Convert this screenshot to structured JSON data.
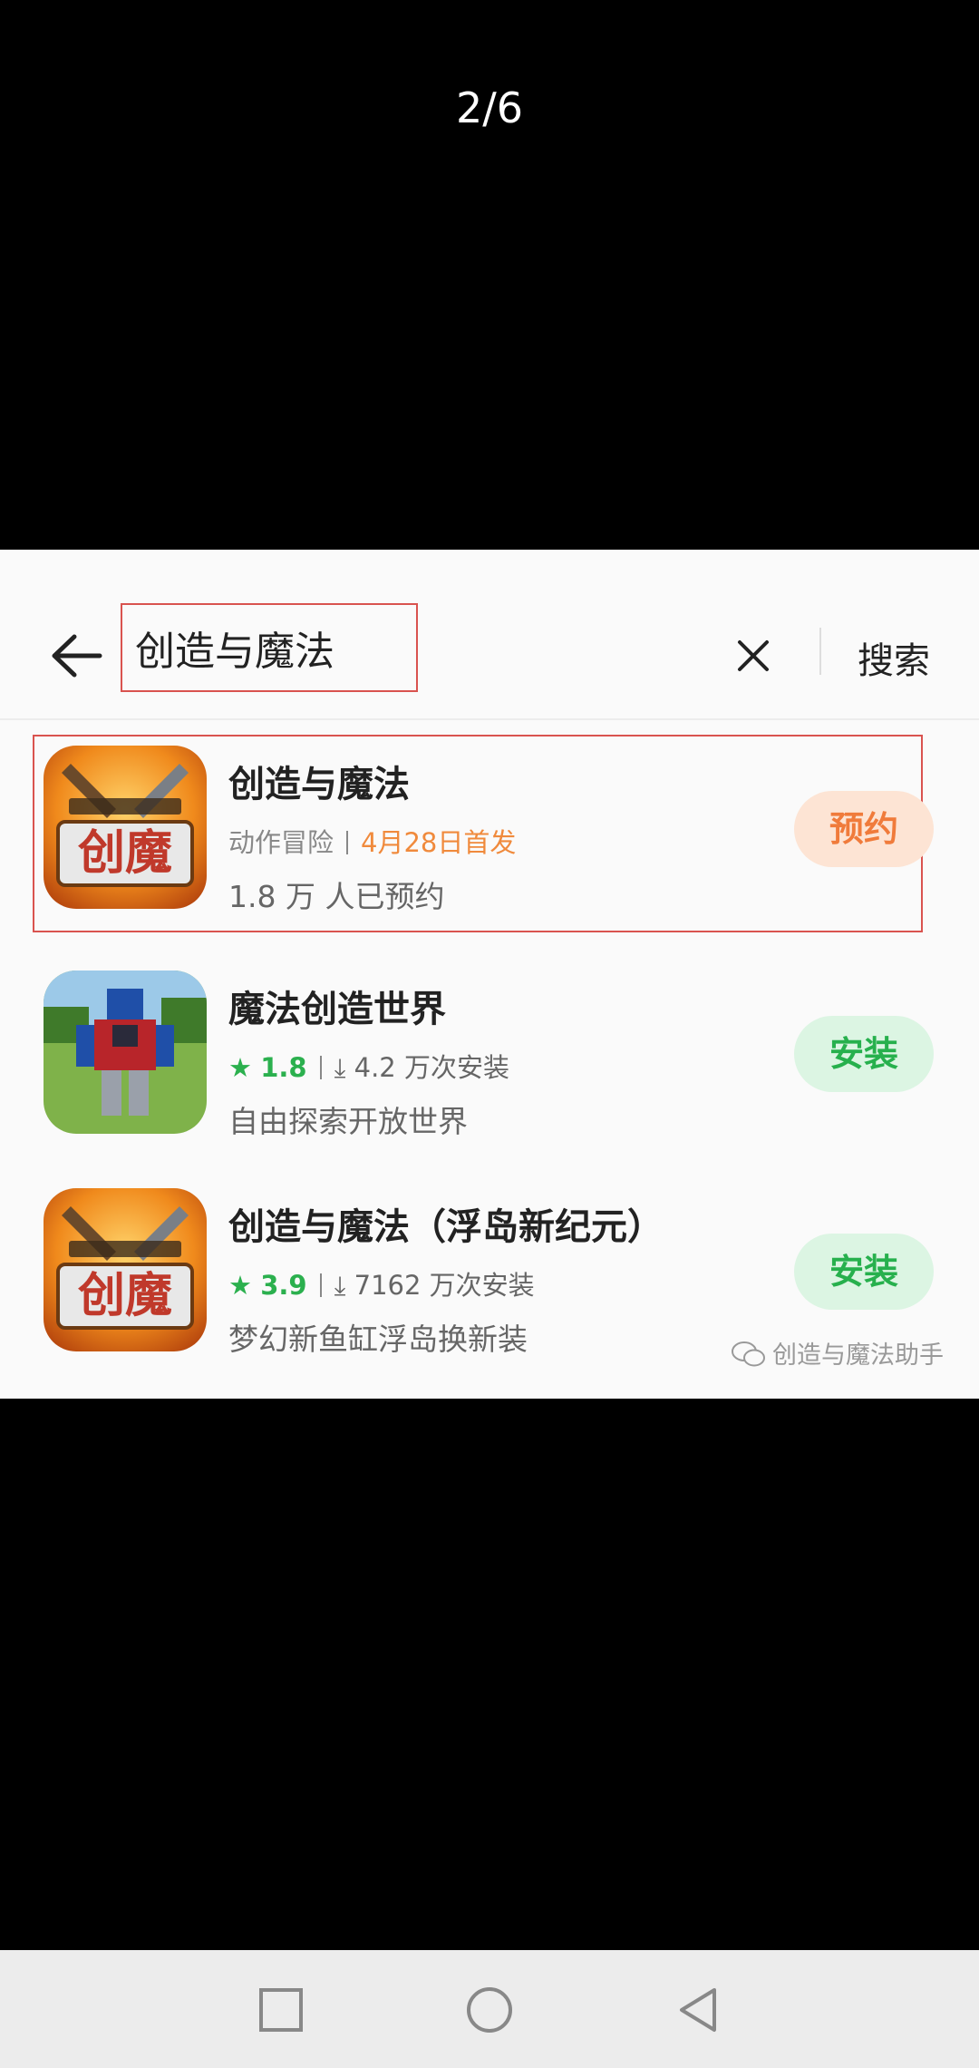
{
  "page_counter": "2/6",
  "search": {
    "query": "创造与魔法",
    "submit_label": "搜索"
  },
  "results": [
    {
      "title": "创造与魔法",
      "category": "动作冒险",
      "release_note": "4月28日首发",
      "stat": "1.8 万 人已预约",
      "action": "预约",
      "icon_text": "创魔"
    },
    {
      "title": "魔法创造世界",
      "rating": "1.8",
      "downloads": "4.2 万次安装",
      "desc": "自由探索开放世界",
      "action": "安装"
    },
    {
      "title": "创造与魔法（浮岛新纪元）",
      "rating": "3.9",
      "downloads": "7162 万次安装",
      "desc": "梦幻新鱼缸浮岛换新装",
      "action": "安装",
      "icon_text": "创魔"
    }
  ],
  "watermark": "创造与魔法助手",
  "colors": {
    "reserve": "#f07b3b",
    "install": "#27b04d",
    "highlight": "#d9534f"
  }
}
